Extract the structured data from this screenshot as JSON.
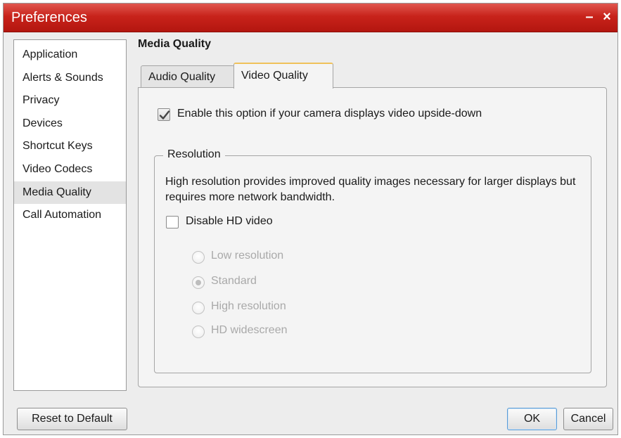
{
  "window": {
    "title": "Preferences",
    "minimize_glyph": "–",
    "close_glyph": "×"
  },
  "sidebar": {
    "items": [
      {
        "label": "Application",
        "active": false
      },
      {
        "label": "Alerts & Sounds",
        "active": false
      },
      {
        "label": "Privacy",
        "active": false
      },
      {
        "label": "Devices",
        "active": false
      },
      {
        "label": "Shortcut Keys",
        "active": false
      },
      {
        "label": "Video Codecs",
        "active": false
      },
      {
        "label": "Media Quality",
        "active": true
      },
      {
        "label": "Call Automation",
        "active": false
      }
    ]
  },
  "main": {
    "section_title": "Media Quality",
    "tabs": [
      {
        "label": "Audio Quality",
        "active": false
      },
      {
        "label": "Video Quality",
        "active": true
      }
    ],
    "upside_down": {
      "label": "Enable this option if your camera displays video upside-down",
      "checked": true
    },
    "resolution": {
      "legend": "Resolution",
      "description": "High resolution provides improved quality images necessary for larger displays but requires more network bandwidth.",
      "disable_hd": {
        "label": "Disable HD video",
        "checked": false
      },
      "options": [
        {
          "label": "Low resolution",
          "selected": false,
          "enabled": false
        },
        {
          "label": "Standard",
          "selected": true,
          "enabled": false
        },
        {
          "label": "High resolution",
          "selected": false,
          "enabled": false
        },
        {
          "label": "HD widescreen",
          "selected": false,
          "enabled": false
        }
      ]
    }
  },
  "footer": {
    "reset_label": "Reset to Default",
    "ok_label": "OK",
    "cancel_label": "Cancel"
  }
}
